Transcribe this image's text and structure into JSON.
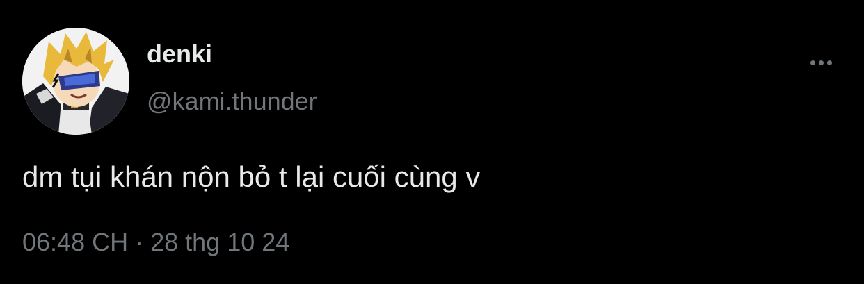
{
  "tweet": {
    "author": {
      "display_name": "denki",
      "handle": "@kami.thunder"
    },
    "text": "dm tụi khán nộn bỏ t lại cuối cùng v",
    "time": "06:48 CH",
    "separator": "·",
    "date": "28 thg 10 24",
    "more_icon": "more-horizontal-icon"
  },
  "colors": {
    "background": "#000000",
    "primary_text": "#e7e9ea",
    "secondary_text": "#71767b"
  }
}
